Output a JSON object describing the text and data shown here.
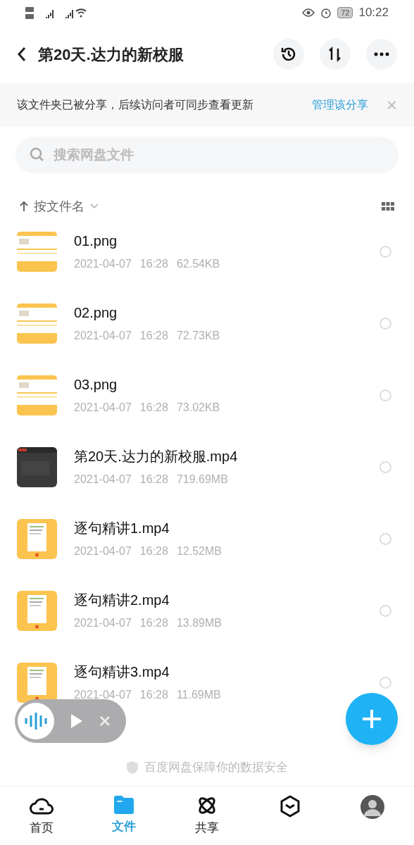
{
  "status_bar": {
    "battery": "72",
    "time": "10:22"
  },
  "header": {
    "title": "第20天.达力的新校服"
  },
  "share_banner": {
    "text": "该文件夹已被分享，后续访问者可同步查看更新",
    "link": "管理该分享",
    "close": "×"
  },
  "search": {
    "placeholder": "搜索网盘文件"
  },
  "sort": {
    "label": "按文件名"
  },
  "files": [
    {
      "name": "01.png",
      "date": "2021-04-07",
      "time": "16:28",
      "size": "62.54KB",
      "selected": false
    },
    {
      "name": "02.png",
      "date": "2021-04-07",
      "time": "16:28",
      "size": "72.73KB",
      "selected": false
    },
    {
      "name": "03.png",
      "date": "2021-04-07",
      "time": "16:28",
      "size": "73.02KB",
      "selected": false
    },
    {
      "name": "第20天.达力的新校服.mp4",
      "date": "2021-04-07",
      "time": "16:28",
      "size": "719.69MB",
      "kind": "dark-video",
      "selected": false
    },
    {
      "name": "逐句精讲1.mp4",
      "date": "2021-04-07",
      "time": "16:28",
      "size": "12.52MB",
      "kind": "phone-video",
      "selected": false
    },
    {
      "name": "逐句精讲2.mp4",
      "date": "2021-04-07",
      "time": "16:28",
      "size": "13.89MB",
      "kind": "phone-video",
      "selected": false
    },
    {
      "name": "逐句精讲3.mp4",
      "date": "2021-04-07",
      "time": "16:28",
      "size": "11.69MB",
      "kind": "phone-video",
      "selected": false
    }
  ],
  "footer": {
    "text": "百度网盘保障你的数据安全"
  },
  "tab_bar": [
    {
      "label": "首页",
      "kind": "cloud",
      "selected": false
    },
    {
      "label": "文件",
      "kind": "folder",
      "selected": true
    },
    {
      "label": "共享",
      "kind": "orbit",
      "selected": false
    },
    {
      "kind": "box",
      "selected": false
    },
    {
      "kind": "avatar",
      "selected": false
    }
  ]
}
